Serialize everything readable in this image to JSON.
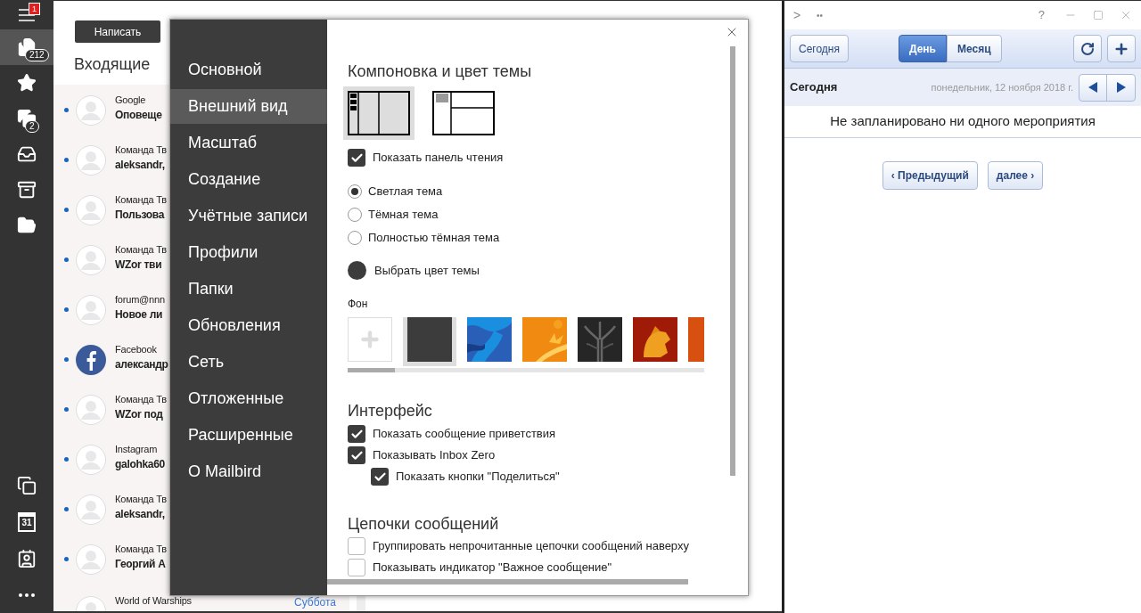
{
  "rail": {
    "menu_badge": "1",
    "items": [
      {
        "kind": "inbox",
        "badge": "212",
        "selected": true
      },
      {
        "kind": "star",
        "selected": false
      },
      {
        "kind": "drafts",
        "badge": "2",
        "selected": false
      },
      {
        "kind": "outbox",
        "selected": false
      },
      {
        "kind": "archive",
        "selected": false
      },
      {
        "kind": "folder",
        "selected": false
      }
    ],
    "bottom": [
      {
        "kind": "copy"
      },
      {
        "kind": "calendar",
        "label": "31"
      },
      {
        "kind": "contacts"
      },
      {
        "kind": "more"
      }
    ]
  },
  "mail": {
    "compose": "Написать",
    "folder_title": "Входящие",
    "messages": [
      {
        "sender": "Google",
        "subject": "Оповеще",
        "unread": true,
        "kind": "person"
      },
      {
        "sender": "Команда Тв",
        "subject": "aleksandr,",
        "unread": true,
        "kind": "person"
      },
      {
        "sender": "Команда Тв",
        "subject": "Пользова",
        "unread": true,
        "kind": "person"
      },
      {
        "sender": "Команда Тв",
        "subject": "WZor тви",
        "unread": true,
        "kind": "person"
      },
      {
        "sender": "forum@nnn",
        "subject": "Новое ли",
        "unread": true,
        "kind": "person"
      },
      {
        "sender": "Facebook",
        "subject": "александр",
        "unread": true,
        "kind": "facebook"
      },
      {
        "sender": "Команда Тв",
        "subject": "WZor под",
        "unread": true,
        "kind": "person"
      },
      {
        "sender": "Instagram",
        "subject": "galohka60",
        "unread": true,
        "kind": "person"
      },
      {
        "sender": "Команда Тв",
        "subject": "aleksandr,",
        "unread": true,
        "kind": "person"
      },
      {
        "sender": "Команда Тв",
        "subject": "Георгий А",
        "unread": true,
        "kind": "person"
      },
      {
        "sender": "World of Warships",
        "date": "Суббота",
        "kind": "person"
      }
    ]
  },
  "settings": {
    "nav": [
      {
        "label": "Основной",
        "selected": false
      },
      {
        "label": "Внешний вид",
        "selected": true
      },
      {
        "label": "Масштаб",
        "selected": false
      },
      {
        "label": "Создание",
        "selected": false
      },
      {
        "label": "Учётные записи",
        "selected": false
      },
      {
        "label": "Профили",
        "selected": false
      },
      {
        "label": "Папки",
        "selected": false
      },
      {
        "label": "Обновления",
        "selected": false
      },
      {
        "label": "Сеть",
        "selected": false
      },
      {
        "label": "Отложенные",
        "selected": false
      },
      {
        "label": "Расширенные",
        "selected": false
      },
      {
        "label": "О Mailbird",
        "selected": false
      }
    ],
    "layout_heading": "Компоновка и цвет темы",
    "layouts": [
      {
        "kind": "three-column",
        "selected": true
      },
      {
        "kind": "split",
        "selected": false
      }
    ],
    "reading_pane": {
      "label": "Показать панель чтения",
      "checked": true
    },
    "themes": [
      {
        "label": "Светлая тема",
        "selected": true
      },
      {
        "label": "Тёмная тема",
        "selected": false
      },
      {
        "label": "Полностью тёмная тема",
        "selected": false
      }
    ],
    "theme_color": {
      "label": "Выбрать цвет темы",
      "color": "#3c3c3c"
    },
    "background_label": "Фон",
    "backgrounds": [
      {
        "kind": "add",
        "selected": false
      },
      {
        "kind": "solid",
        "selected": true
      },
      {
        "kind": "picture",
        "selected": false
      },
      {
        "kind": "picture",
        "selected": false
      },
      {
        "kind": "picture",
        "selected": false
      },
      {
        "kind": "picture",
        "selected": false
      },
      {
        "kind": "picture",
        "selected": false
      }
    ],
    "interface_heading": "Интерфейс",
    "interface_options": [
      {
        "label": "Показать сообщение приветствия",
        "checked": true
      },
      {
        "label": "Показывать Inbox Zero",
        "checked": true,
        "children": [
          {
            "label": "Показать кнопки \"Поделиться\"",
            "checked": true
          }
        ]
      }
    ],
    "threads_heading": "Цепочки сообщений",
    "thread_options": [
      {
        "label": "Группировать непрочитанные цепочки сообщений наверху",
        "checked": false
      },
      {
        "label": "Показывать индикатор \"Важное сообщение\"",
        "checked": false
      }
    ]
  },
  "calendar": {
    "nav_glyph": ">",
    "dots": "••",
    "help": "?",
    "today_button": "Сегодня",
    "views": [
      {
        "label": "День",
        "selected": true
      },
      {
        "label": "Месяц",
        "selected": false
      }
    ],
    "day_title": "Сегодня",
    "date": "понедельник, 12 ноября 2018 г.",
    "empty_message": "Не запланировано ни одного мероприятия",
    "prev_button": "‹ Предыдущий",
    "next_button": "далее ›"
  }
}
